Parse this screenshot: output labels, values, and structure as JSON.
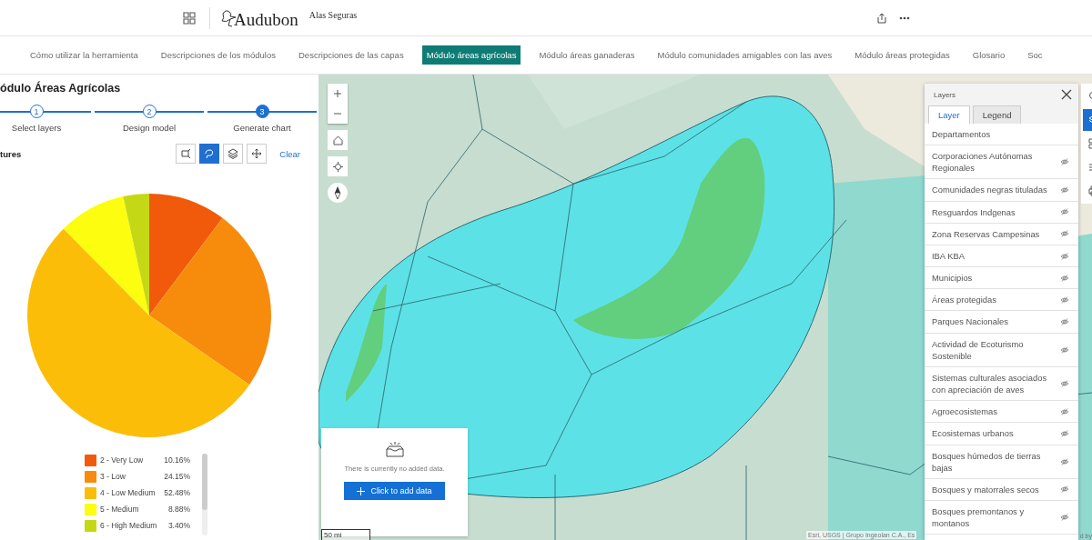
{
  "header": {
    "logo_text": "Audubon",
    "app_title": "Alas Seguras"
  },
  "nav": [
    {
      "label": "Cómo utilizar la herramienta",
      "selected": false
    },
    {
      "label": "Descripciones de los módulos",
      "selected": false
    },
    {
      "label": "Descripciones de las capas",
      "selected": false
    },
    {
      "label": "Módulo áreas agrícolas",
      "selected": true
    },
    {
      "label": "Módulo áreas ganaderas",
      "selected": false
    },
    {
      "label": "Módulo comunidades amigables con las aves",
      "selected": false
    },
    {
      "label": "Módulo áreas protegidas",
      "selected": false
    },
    {
      "label": "Glosario",
      "selected": false
    },
    {
      "label": "Soc",
      "selected": false
    }
  ],
  "panel": {
    "title": "ódulo Áreas Agrícolas",
    "steps": [
      {
        "number": "1",
        "label": "Select layers",
        "selected": false
      },
      {
        "number": "2",
        "label": "Design model",
        "selected": false
      },
      {
        "number": "3",
        "label": "Generate chart",
        "selected": true
      }
    ],
    "section_label": "tures",
    "tools": [
      {
        "kind": "select",
        "selected": false
      },
      {
        "kind": "lasso",
        "selected": true
      },
      {
        "kind": "layers",
        "selected": false
      },
      {
        "kind": "pan",
        "selected": false
      }
    ],
    "clear_label": "Clear",
    "chart_data": {
      "type": "pie",
      "categories": [
        "2 - Very Low",
        "3 - Low",
        "4 - Low Medium",
        "5 - Medium",
        "6 - High Medium"
      ],
      "values": [
        10.16,
        24.15,
        52.48,
        8.88,
        3.4
      ]
    },
    "legend": [
      {
        "value": "10.16%",
        "color": "#f05a0a"
      },
      {
        "value": "24.15%",
        "color": "#f78b0c"
      },
      {
        "value": "52.48%",
        "color": "#fbbd08"
      },
      {
        "value": "8.88%",
        "color": "#fdfd10"
      },
      {
        "value": "3.40%",
        "color": "#c5d816"
      }
    ]
  },
  "map": {
    "add_data": {
      "message": "There is currently no added data.",
      "button": "Click to add data"
    },
    "scale": "50 mi",
    "attribution": "Esri, USGS | Grupo Ingeolan C.A., Es",
    "attribution_tail": "d by",
    "layers_panel": {
      "title": "Layers",
      "tabs": [
        {
          "label": "Layer",
          "selected": true
        },
        {
          "label": "Legend",
          "selected": false
        }
      ],
      "items": [
        {
          "label": "Departamentos",
          "hidden": false
        },
        {
          "label": "Corporaciones Autónomas Regionales",
          "hidden": true
        },
        {
          "label": "Comunidades negras tituladas",
          "hidden": true
        },
        {
          "label": "Resguardos Indgenas",
          "hidden": true
        },
        {
          "label": "Zona Reservas Campesinas",
          "hidden": true
        },
        {
          "label": "IBA KBA",
          "hidden": true
        },
        {
          "label": "Municipios",
          "hidden": true
        },
        {
          "label": "Áreas protegidas",
          "hidden": true
        },
        {
          "label": "Parques Nacionales",
          "hidden": true
        },
        {
          "label": "Actividad de Ecoturismo Sostenible",
          "hidden": true
        },
        {
          "label": "Sistemas culturales asociados con apreciación de aves",
          "hidden": true
        },
        {
          "label": "Agroecosistemas",
          "hidden": true
        },
        {
          "label": "Ecosistemas urbanos",
          "hidden": true
        },
        {
          "label": "Bosques húmedos de tierras bajas",
          "hidden": true
        },
        {
          "label": "Bosques y matorrales secos",
          "hidden": true
        },
        {
          "label": "Bosques premontanos y montanos",
          "hidden": true
        }
      ]
    },
    "toolbar": [
      {
        "kind": "search",
        "selected": false
      },
      {
        "kind": "layers",
        "selected": true
      },
      {
        "kind": "basemap",
        "selected": false
      },
      {
        "kind": "list",
        "selected": false
      },
      {
        "kind": "print",
        "selected": false
      }
    ]
  }
}
